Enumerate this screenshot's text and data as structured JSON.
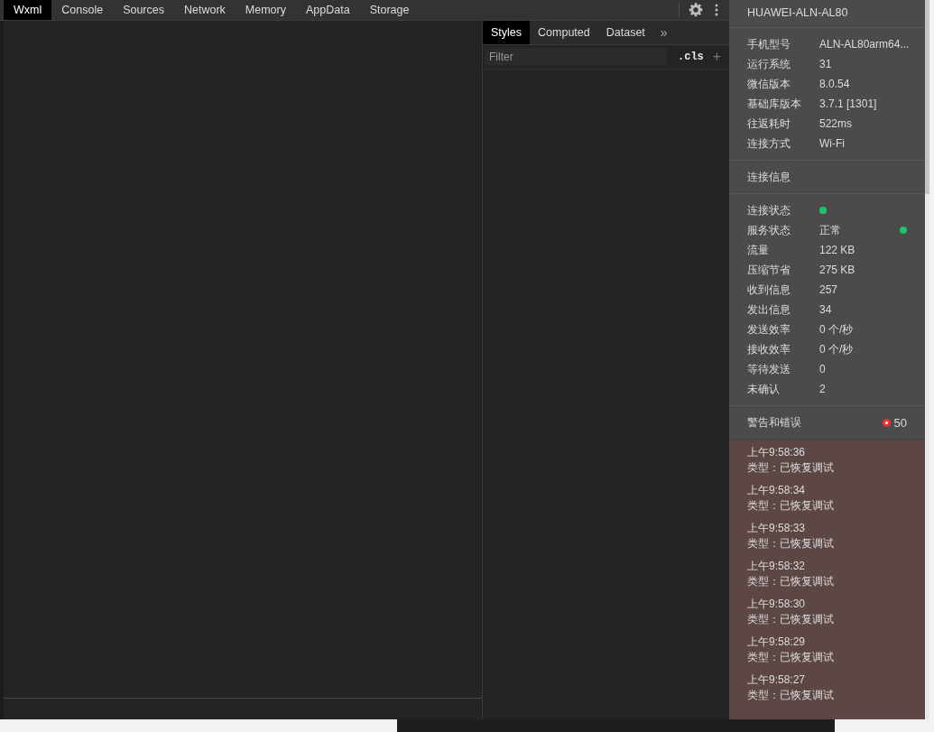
{
  "main_tabs": [
    {
      "label": "Wxml",
      "selected": true
    },
    {
      "label": "Console",
      "selected": false
    },
    {
      "label": "Sources",
      "selected": false
    },
    {
      "label": "Network",
      "selected": false
    },
    {
      "label": "Memory",
      "selected": false
    },
    {
      "label": "AppData",
      "selected": false
    },
    {
      "label": "Storage",
      "selected": false
    }
  ],
  "styles_pane": {
    "tabs": [
      {
        "label": "Styles",
        "selected": true
      },
      {
        "label": "Computed",
        "selected": false
      },
      {
        "label": "Dataset",
        "selected": false
      }
    ],
    "more": "»",
    "filter": {
      "placeholder": "Filter"
    },
    "cls_button": ".cls",
    "add_button": "+"
  },
  "device_panel": {
    "title": "HUAWEI-ALN-AL80",
    "device_info": [
      {
        "label": "手机型号",
        "value": "ALN-AL80arm64..."
      },
      {
        "label": "运行系统",
        "value": "31"
      },
      {
        "label": "微信版本",
        "value": "8.0.54"
      },
      {
        "label": "基础库版本",
        "value": "3.7.1 [1301]"
      },
      {
        "label": "往返耗时",
        "value": "522ms"
      },
      {
        "label": "连接方式",
        "value": "Wi-Fi"
      }
    ],
    "connection_heading": "连接信息",
    "connection_info": [
      {
        "kind": "dot",
        "label": "连接状态",
        "color": "#19c66f"
      },
      {
        "kind": "text_dot",
        "label": "服务状态",
        "value": "正常",
        "color": "#19c66f"
      },
      {
        "kind": "text",
        "label": "流量",
        "value": "122 KB"
      },
      {
        "kind": "text",
        "label": "压缩节省",
        "value": "275 KB"
      },
      {
        "kind": "text",
        "label": "收到信息",
        "value": "257"
      },
      {
        "kind": "text",
        "label": "发出信息",
        "value": "34"
      },
      {
        "kind": "text",
        "label": "发送效率",
        "value": "0 个/秒"
      },
      {
        "kind": "text",
        "label": "接收效率",
        "value": "0 个/秒"
      },
      {
        "kind": "text",
        "label": "等待发送",
        "value": "0"
      },
      {
        "kind": "text",
        "label": "未确认",
        "value": "2"
      }
    ],
    "warnings": {
      "heading": "警告和错误",
      "count": "50"
    },
    "log": [
      {
        "time": "上午9:58:36",
        "type": "类型：已恢复调试"
      },
      {
        "time": "上午9:58:34",
        "type": "类型：已恢复调试"
      },
      {
        "time": "上午9:58:33",
        "type": "类型：已恢复调试"
      },
      {
        "time": "上午9:58:32",
        "type": "类型：已恢复调试"
      },
      {
        "time": "上午9:58:30",
        "type": "类型：已恢复调试"
      },
      {
        "time": "上午9:58:29",
        "type": "类型：已恢复调试"
      },
      {
        "time": "上午9:58:27",
        "type": "类型：已恢复调试"
      }
    ]
  }
}
